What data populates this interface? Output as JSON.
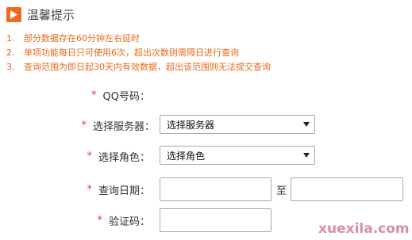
{
  "header": {
    "title": "温馨提示",
    "icon": "play-icon"
  },
  "notes": [
    {
      "num": "1.",
      "text": "部分数据存在60分钟左右延时"
    },
    {
      "num": "2.",
      "text": "单项功能每日只可使用6次，超出次数则需隔日进行查询"
    },
    {
      "num": "3.",
      "text": "查询范围为即日起30天内有效数据，超出该范围则无法提交查询"
    }
  ],
  "form": {
    "qq": {
      "star": "*",
      "label": "QQ号码："
    },
    "server": {
      "star": "*",
      "label": "选择服务器：",
      "selected": "选择服务器"
    },
    "role": {
      "star": "*",
      "label": "选择角色：",
      "selected": "选择角色"
    },
    "date": {
      "star": "*",
      "label": "查询日期：",
      "to_label": "至",
      "start_value": "",
      "end_value": ""
    },
    "captcha": {
      "star": "*",
      "label": "验证码：",
      "value": ""
    }
  },
  "colors": {
    "accent": "#f06a1e",
    "note_text": "#e8691c",
    "required_star": "#e23c3c"
  },
  "watermark": "xuexila.com"
}
